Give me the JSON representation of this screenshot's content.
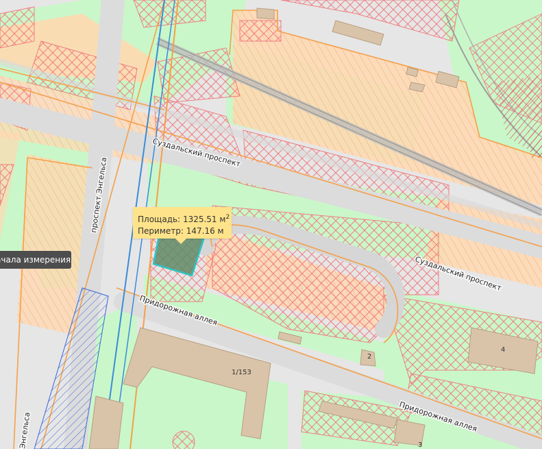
{
  "measure_tooltip": {
    "area_label": "Площадь:",
    "area_value": "1325.51 м",
    "area_sup": "2",
    "perimeter_label": "Периметр:",
    "perimeter_value": "147.16 м"
  },
  "side_tooltip": {
    "text": "ачала измерения"
  },
  "streets": {
    "suzdalsky_1": "Суздальский проспект",
    "suzdalsky_2": "Суздальский проспект",
    "engelsa_1": "проспект Энгельса",
    "engelsa_2": "Энгельса",
    "pridorozhnaya_1": "Придорожная аллея",
    "pridorozhnaya_2": "Придорожная аллея"
  },
  "houses": {
    "h1": "1/153",
    "h2": "2",
    "h3": "3",
    "h4": "4"
  },
  "colors": {
    "background": "#e6e6e6",
    "greenery": "#c9f7c9",
    "zone_orange": "#ffd8b0",
    "hatch_red": "#f2878a",
    "building": "#d9c4aa",
    "tooltip": "#ffe38a",
    "measure_polygon": "#5f8a66",
    "measure_outline": "#2ec4c4"
  }
}
